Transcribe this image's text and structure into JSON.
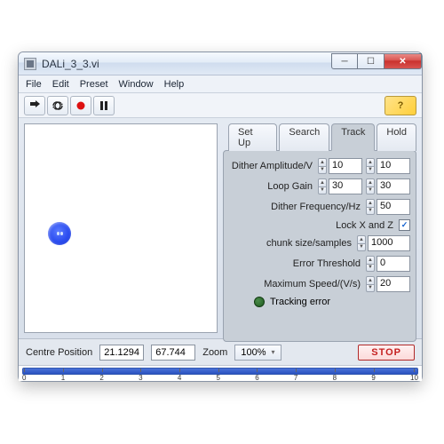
{
  "window": {
    "title": "DALi_3_3.vi"
  },
  "menu": {
    "file": "File",
    "edit": "Edit",
    "preset": "Preset",
    "window": "Window",
    "help": "Help"
  },
  "toolbar": {
    "help_badge": "?"
  },
  "tabs": {
    "setup": "Set Up",
    "search": "Search",
    "track": "Track",
    "hold": "Hold"
  },
  "track": {
    "dither_amp_label": "Dither Amplitude/V",
    "dither_amp_a": "10",
    "dither_amp_b": "10",
    "loop_gain_label": "Loop Gain",
    "loop_gain_a": "30",
    "loop_gain_b": "30",
    "dither_freq_label": "Dither Frequency/Hz",
    "dither_freq": "50",
    "lock_label": "Lock X and Z",
    "lock_checked": "✓",
    "chunk_label": "chunk size/samples",
    "chunk": "1000",
    "err_thresh_label": "Error Threshold",
    "err_thresh": "0",
    "max_speed_label": "Maximum Speed/(V/s)",
    "max_speed": "20",
    "tracking_error_label": "Tracking error"
  },
  "status": {
    "centre_label": "Centre Position",
    "centre_x": "21.1294",
    "centre_y": "67.744",
    "zoom_label": "Zoom",
    "zoom_value": "100%",
    "stop": "STOP"
  },
  "ruler": {
    "ticks": [
      "0",
      "1",
      "2",
      "3",
      "4",
      "5",
      "6",
      "7",
      "8",
      "9",
      "10"
    ]
  }
}
